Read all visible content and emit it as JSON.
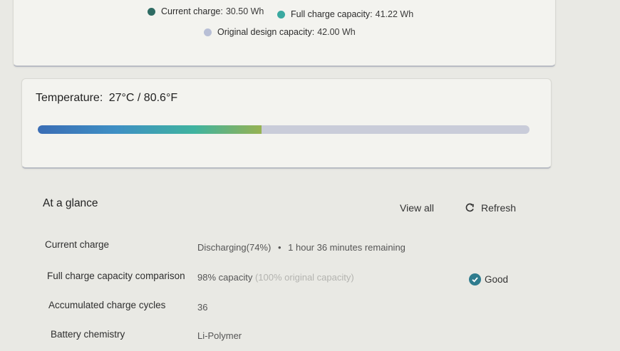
{
  "legend": {
    "current": {
      "label": "Current charge:",
      "value": "30.50 Wh",
      "color": "#2e6b63"
    },
    "full": {
      "label": "Full charge capacity:",
      "value": "41.22 Wh",
      "color": "#3aa9a0"
    },
    "design": {
      "label": "Original design capacity:",
      "value": "42.00 Wh",
      "color": "#b8bfd6"
    }
  },
  "temperature": {
    "label": "Temperature:",
    "value": "27°C / 80.6°F",
    "level": 0.455
  },
  "glance": {
    "title": "At a glance",
    "view_all": "View all",
    "refresh": "Refresh",
    "rows": [
      {
        "label": "Current charge",
        "value": "Discharging(74%)",
        "sep": "•",
        "extra": "1 hour 36 minutes remaining"
      },
      {
        "label": "Full charge capacity comparison",
        "value": "98% capacity",
        "extra": "(100% original capacity)",
        "status": "Good"
      },
      {
        "label": "Accumulated charge cycles",
        "value": "36"
      },
      {
        "label": "Battery chemistry",
        "value": "Li-Polymer"
      }
    ]
  }
}
